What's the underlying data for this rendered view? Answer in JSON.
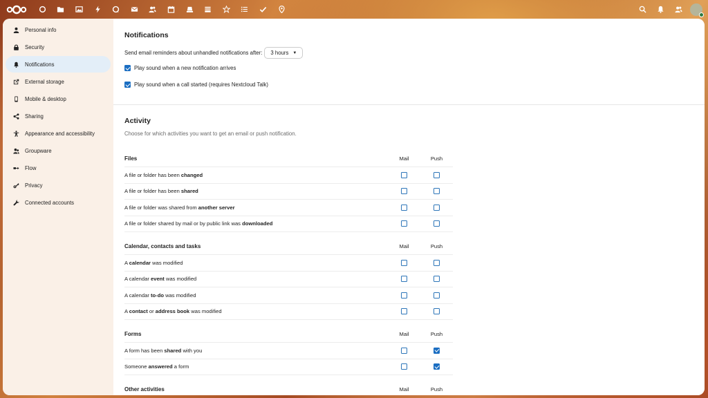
{
  "header": {
    "logo": "nextcloud-logo",
    "apps": [
      {
        "name": "dashboard-icon"
      },
      {
        "name": "files-icon"
      },
      {
        "name": "photos-icon"
      },
      {
        "name": "activity-icon"
      },
      {
        "name": "talk-icon"
      },
      {
        "name": "mail-icon"
      },
      {
        "name": "contacts-icon"
      },
      {
        "name": "calendar-icon"
      },
      {
        "name": "notes-icon"
      },
      {
        "name": "deck-icon"
      },
      {
        "name": "forms-icon"
      },
      {
        "name": "tasks-list-icon"
      },
      {
        "name": "tasks-check-icon"
      },
      {
        "name": "maps-icon"
      }
    ],
    "right": [
      "search-icon",
      "notifications-icon",
      "contacts-menu-icon"
    ]
  },
  "sidebar": {
    "items": [
      {
        "label": "Personal info",
        "icon": "person-icon"
      },
      {
        "label": "Security",
        "icon": "lock-icon"
      },
      {
        "label": "Notifications",
        "icon": "bell-icon",
        "active": true
      },
      {
        "label": "External storage",
        "icon": "external-link-icon"
      },
      {
        "label": "Mobile & desktop",
        "icon": "phone-icon"
      },
      {
        "label": "Sharing",
        "icon": "share-icon"
      },
      {
        "label": "Appearance and accessibility",
        "icon": "accessibility-icon"
      },
      {
        "label": "Groupware",
        "icon": "groupware-icon"
      },
      {
        "label": "Flow",
        "icon": "flow-icon"
      },
      {
        "label": "Privacy",
        "icon": "key-icon"
      },
      {
        "label": "Connected accounts",
        "icon": "wrench-icon"
      }
    ]
  },
  "notifications": {
    "title": "Notifications",
    "reminder_label": "Send email reminders about unhandled notifications after:",
    "reminder_value": "3 hours",
    "play_sound_notification": "Play sound when a new notification arrives",
    "play_sound_call": "Play sound when a call started (requires Nextcloud Talk)"
  },
  "activity": {
    "title": "Activity",
    "description": "Choose for which activities you want to get an email or push notification.",
    "mail_label": "Mail",
    "push_label": "Push",
    "groups": [
      {
        "title": "Files",
        "rows": [
          {
            "parts": [
              "A file or folder has been ",
              "changed",
              ""
            ],
            "mail": false,
            "push": false
          },
          {
            "parts": [
              "A file or folder has been ",
              "shared",
              ""
            ],
            "mail": false,
            "push": false
          },
          {
            "parts": [
              "A file or folder was shared from ",
              "another server",
              ""
            ],
            "mail": false,
            "push": false
          },
          {
            "parts": [
              "A file or folder shared by mail or by public link was ",
              "downloaded",
              ""
            ],
            "mail": false,
            "push": false
          }
        ]
      },
      {
        "title": "Calendar, contacts and tasks",
        "rows": [
          {
            "parts": [
              "A ",
              "calendar",
              " was modified"
            ],
            "mail": false,
            "push": false
          },
          {
            "parts": [
              "A calendar ",
              "event",
              " was modified"
            ],
            "mail": false,
            "push": false
          },
          {
            "parts": [
              "A calendar ",
              "to-do",
              " was modified"
            ],
            "mail": false,
            "push": false
          },
          {
            "parts": [
              "A ",
              "contact",
              " or ",
              "address book",
              " was modified"
            ],
            "mail": false,
            "push": false
          }
        ]
      },
      {
        "title": "Forms",
        "rows": [
          {
            "parts": [
              "A form has been ",
              "shared",
              " with you"
            ],
            "mail": false,
            "push": true
          },
          {
            "parts": [
              "Someone ",
              "answered",
              " a form"
            ],
            "mail": false,
            "push": true
          }
        ]
      },
      {
        "title": "Other activities",
        "rows": []
      }
    ]
  },
  "colors": {
    "accent": "#1b6ec2",
    "active_nav_bg": "#e3eef8",
    "status_online": "#2d7b41"
  }
}
